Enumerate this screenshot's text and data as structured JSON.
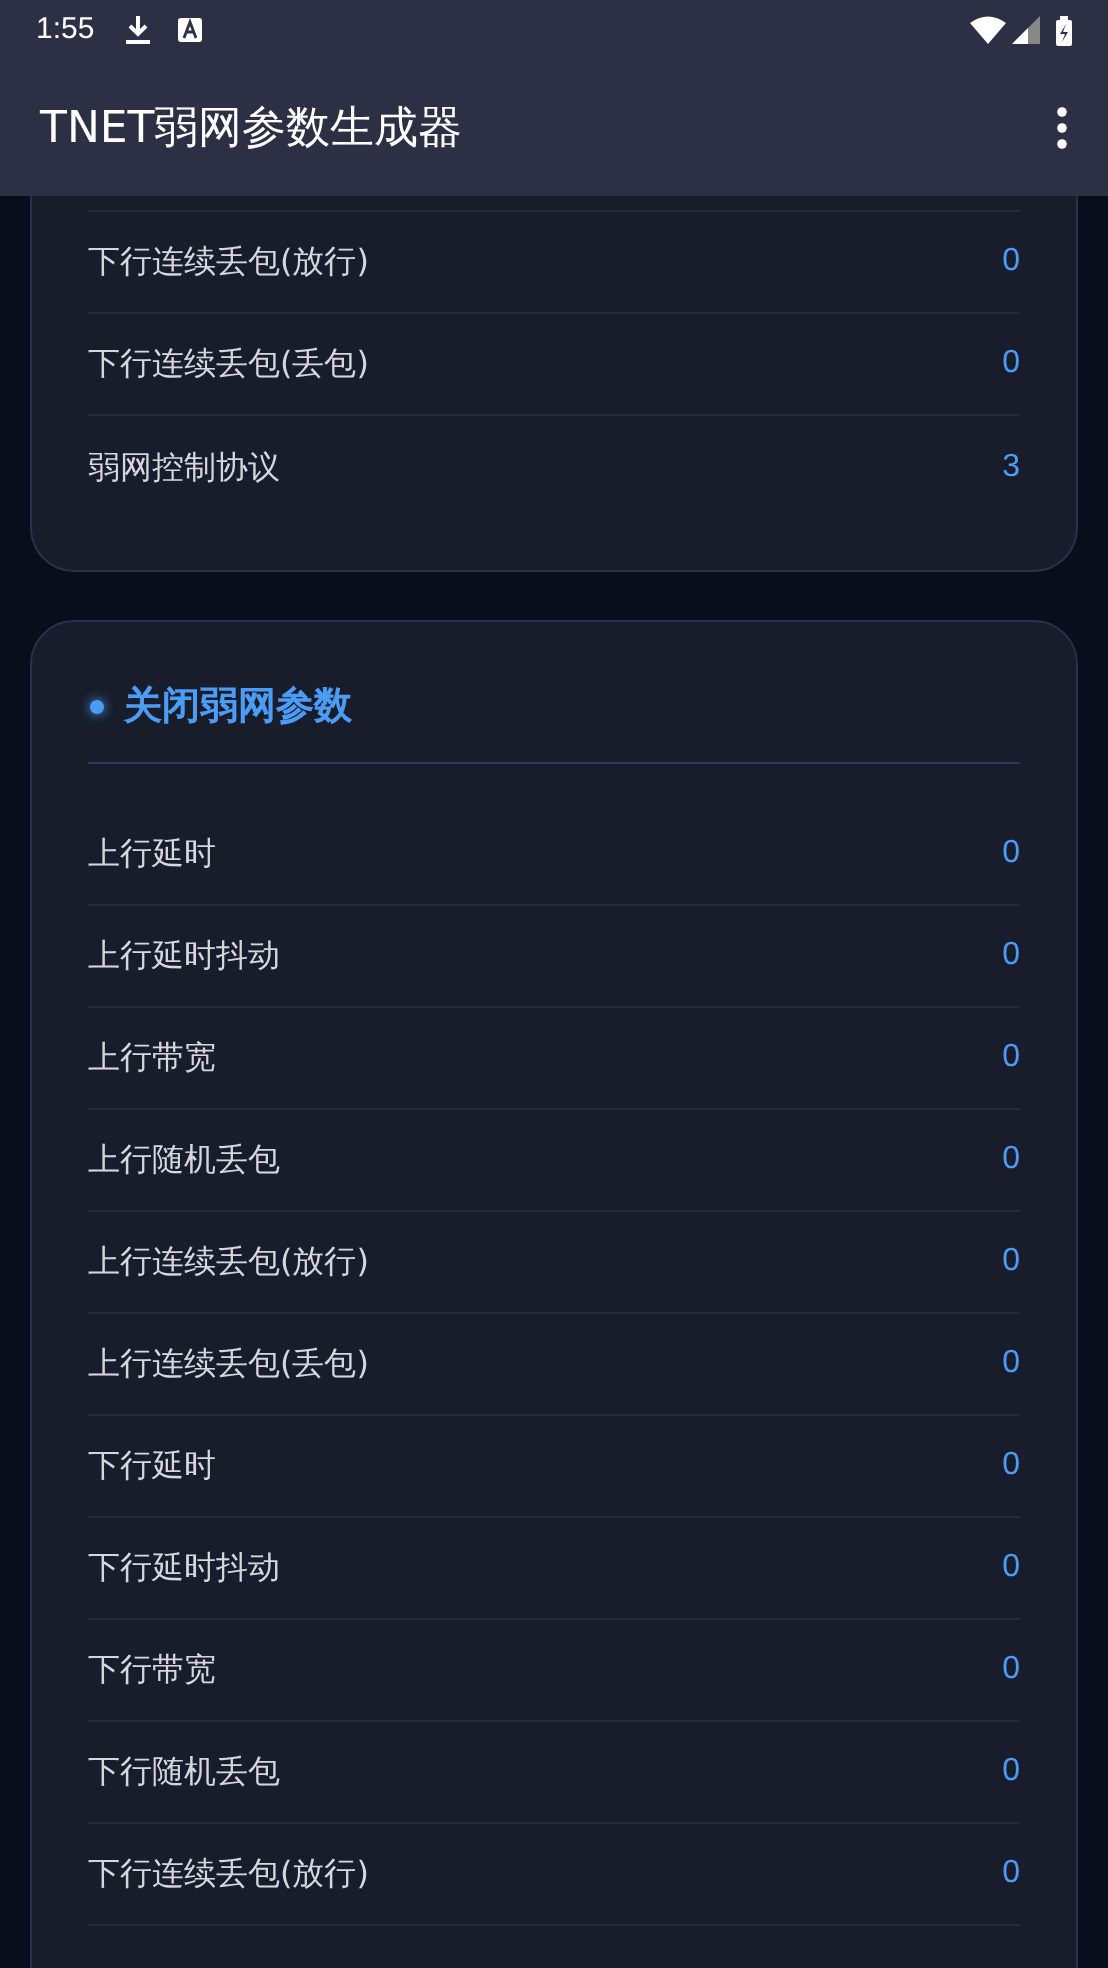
{
  "status_bar": {
    "time": "1:55"
  },
  "app_bar": {
    "title": "TNET弱网参数生成器"
  },
  "sections": [
    {
      "rows": [
        {
          "label": "下行连续丢包(放行)",
          "value": "0"
        },
        {
          "label": "下行连续丢包(丢包)",
          "value": "0"
        },
        {
          "label": "弱网控制协议",
          "value": "3"
        }
      ]
    },
    {
      "title": "关闭弱网参数",
      "rows": [
        {
          "label": "上行延时",
          "value": "0"
        },
        {
          "label": "上行延时抖动",
          "value": "0"
        },
        {
          "label": "上行带宽",
          "value": "0"
        },
        {
          "label": "上行随机丢包",
          "value": "0"
        },
        {
          "label": "上行连续丢包(放行)",
          "value": "0"
        },
        {
          "label": "上行连续丢包(丢包)",
          "value": "0"
        },
        {
          "label": "下行延时",
          "value": "0"
        },
        {
          "label": "下行延时抖动",
          "value": "0"
        },
        {
          "label": "下行带宽",
          "value": "0"
        },
        {
          "label": "下行随机丢包",
          "value": "0"
        },
        {
          "label": "下行连续丢包(放行)",
          "value": "0"
        }
      ]
    }
  ]
}
